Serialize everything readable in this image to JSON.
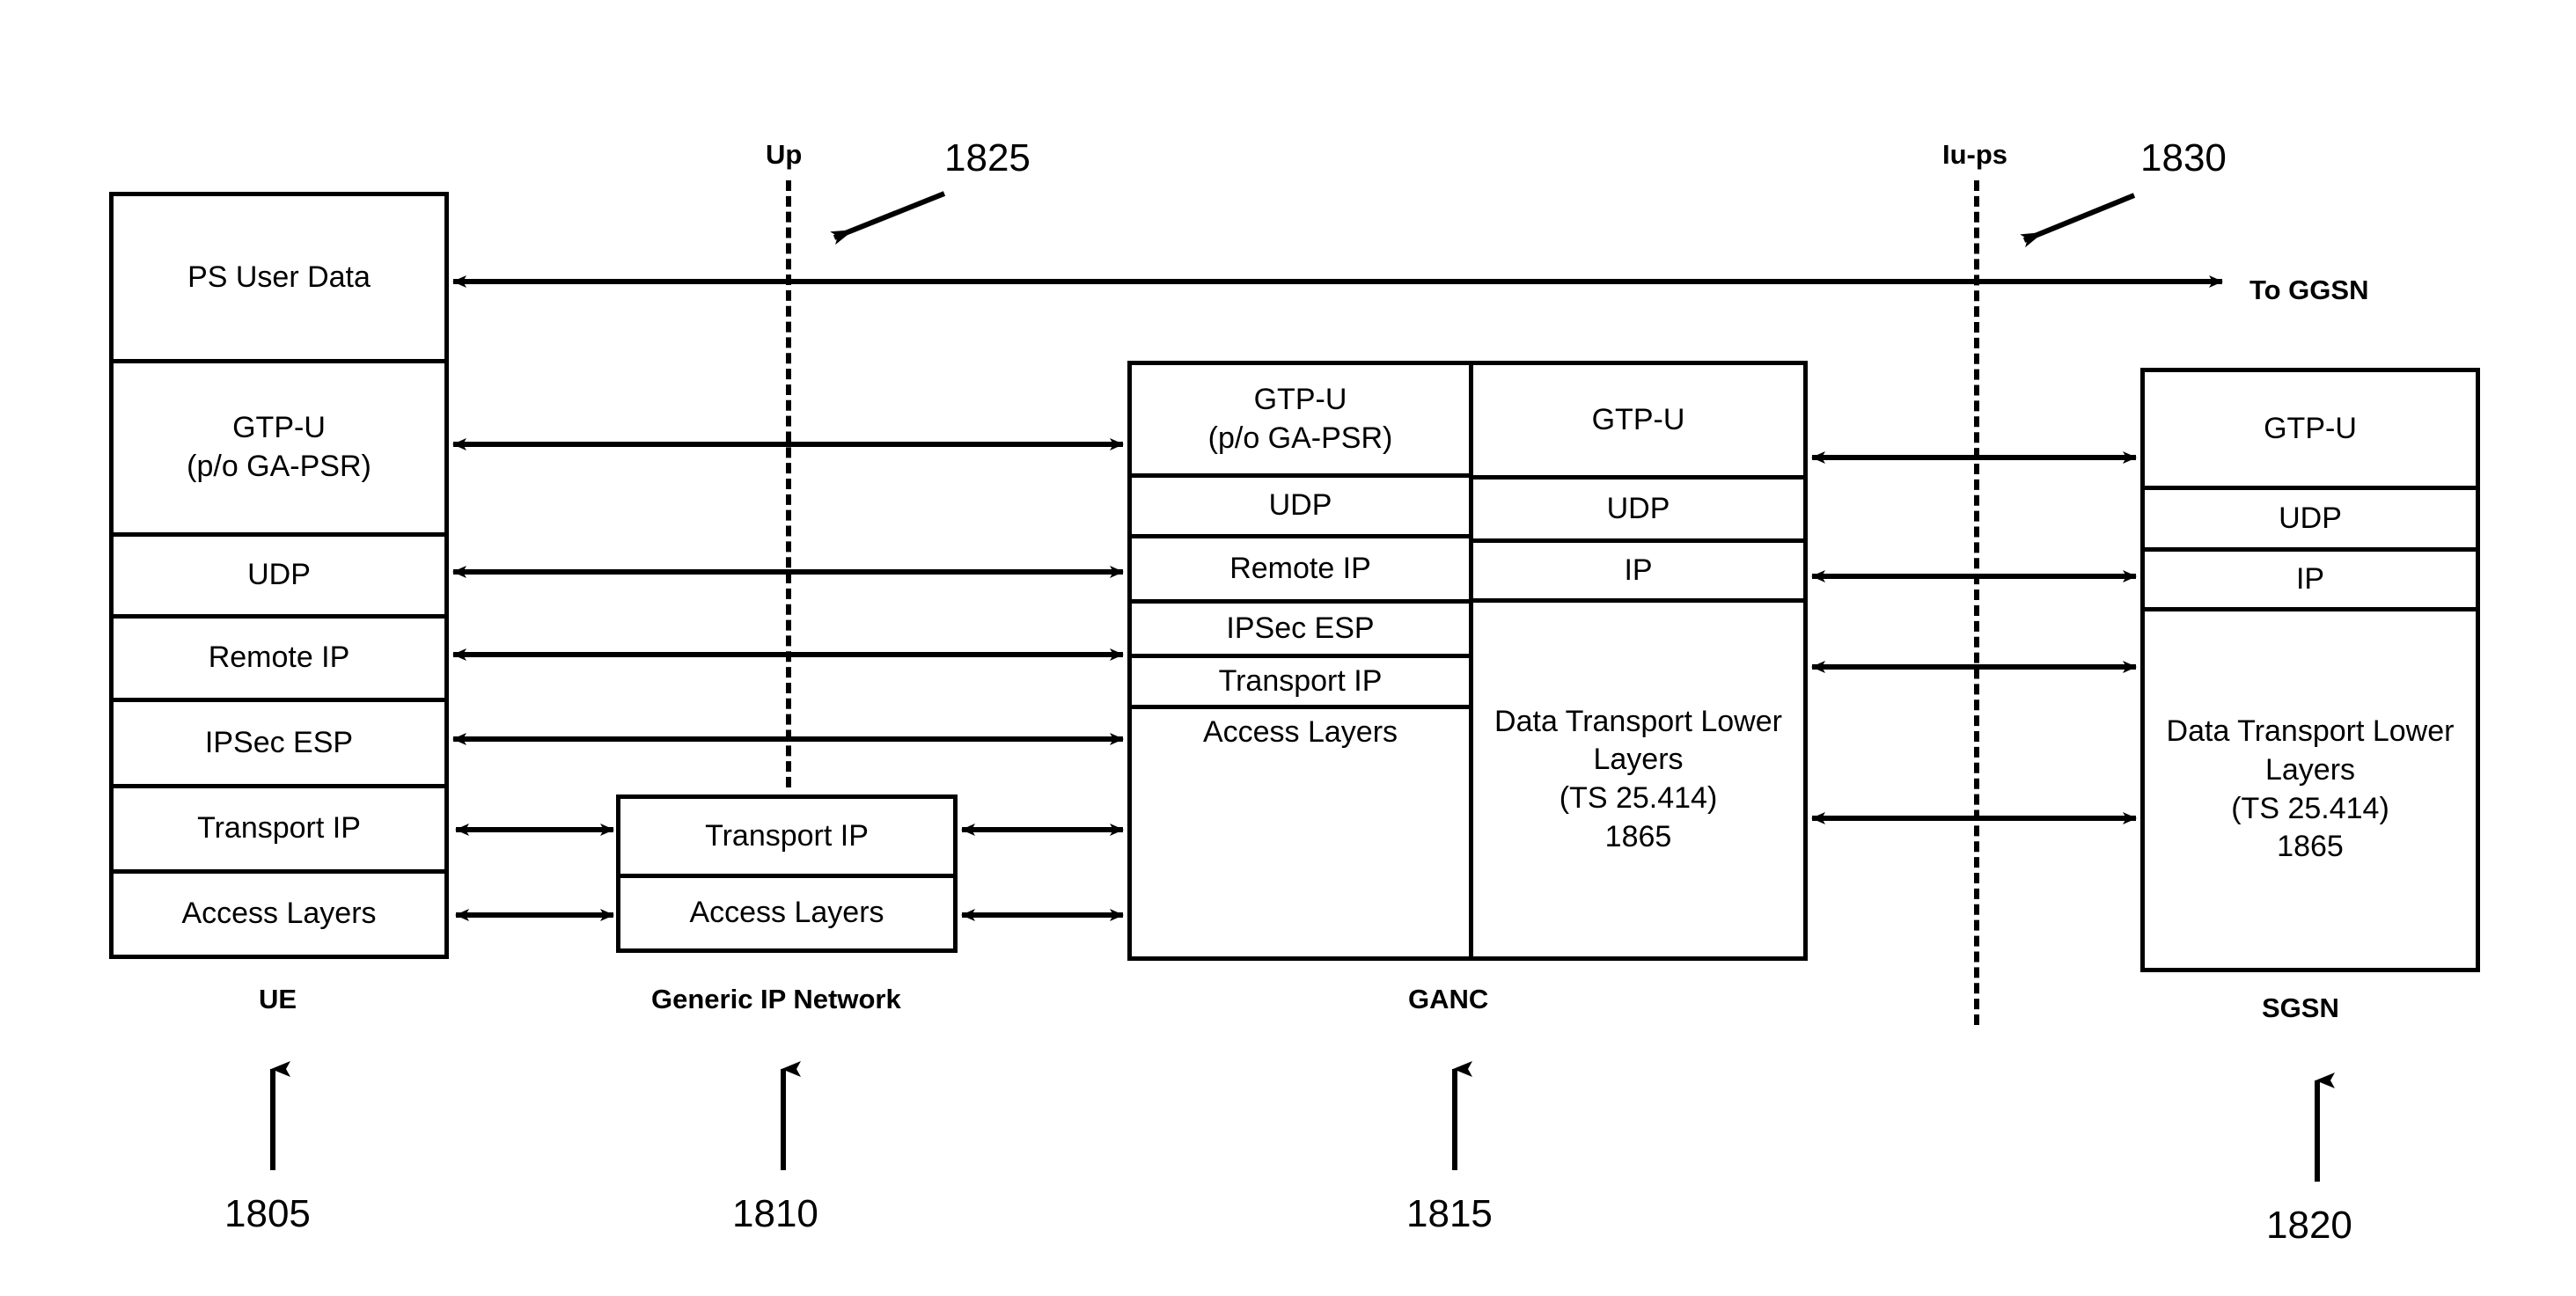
{
  "diagram": {
    "title_hidden": "",
    "interfaces": [
      {
        "name": "up-interface",
        "label": "Up"
      },
      {
        "name": "iu-ps-interface",
        "label": "Iu-ps"
      }
    ],
    "callouts": [
      {
        "name": "callout-1825",
        "label": "1825"
      },
      {
        "name": "callout-1830",
        "label": "1830"
      }
    ],
    "external_link": {
      "label": "To GGSN"
    },
    "nodes": [
      {
        "name": "ue",
        "label": "UE",
        "ref": "1805"
      },
      {
        "name": "generic-ip-net",
        "label": "Generic IP Network",
        "ref": "1810"
      },
      {
        "name": "ganc",
        "label": "GANC",
        "ref": "1815"
      },
      {
        "name": "sgsn",
        "label": "SGSN",
        "ref": "1820"
      }
    ],
    "stacks": {
      "ue": {
        "layers": [
          "PS User Data",
          "GTP-U\n(p/o GA-PSR)",
          "UDP",
          "Remote IP",
          "IPSec ESP",
          "Transport IP",
          "Access Layers"
        ]
      },
      "generic_ip_network": {
        "layers": [
          "Transport IP",
          "Access Layers"
        ]
      },
      "ganc_left": {
        "layers": [
          "GTP-U\n(p/o GA-PSR)",
          "UDP",
          "Remote IP",
          "IPSec ESP",
          "Transport IP",
          "Access Layers"
        ]
      },
      "ganc_right": {
        "layers": [
          "GTP-U",
          "UDP",
          "IP",
          "Data Transport Lower\nLayers\n(TS 25.414)\n1865"
        ]
      },
      "sgsn": {
        "layers": [
          "GTP-U",
          "UDP",
          "IP",
          "Data Transport Lower\nLayers\n(TS 25.414)\n1865"
        ]
      }
    },
    "inner_refs": [
      {
        "name": "ganc-dtll-ref",
        "label": "1865"
      },
      {
        "name": "sgsn-dtll-ref",
        "label": "1865"
      }
    ],
    "colors": {
      "stroke": "#000000",
      "background": "#ffffff"
    }
  }
}
